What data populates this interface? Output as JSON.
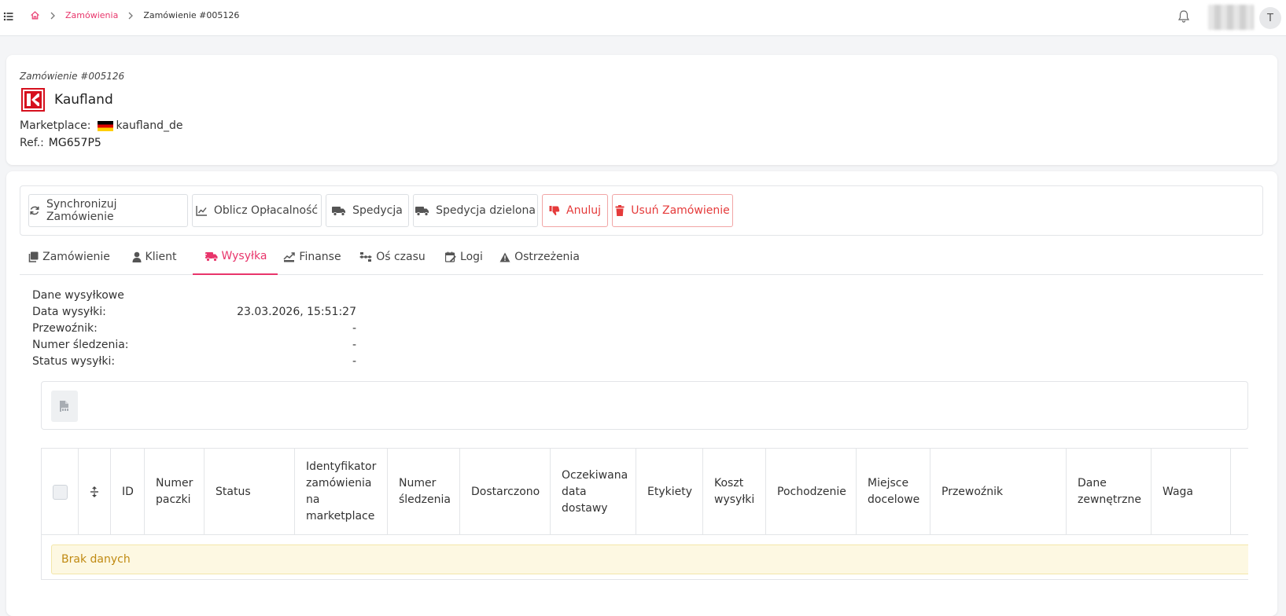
{
  "topbar": {
    "breadcrumb": {
      "home_icon": "home-icon",
      "link": "Zamówienia",
      "current": "Zamówienie #005126"
    },
    "avatar_letter": "T"
  },
  "header": {
    "order_number": "Zamówienie #005126",
    "shop_name": "Kaufland",
    "marketplace_label": "Marketplace:",
    "marketplace_value": "kaufland_de",
    "ref_label": "Ref.:",
    "ref_value": "MG657P5"
  },
  "actions": {
    "sync": "Synchronizuj Zamówienie",
    "profit": "Oblicz Opłacalność",
    "shipment": "Spedycja",
    "split_shipment": "Spedycja dzielona",
    "cancel": "Anuluj",
    "delete": "Usuń Zamówienie"
  },
  "tabs": {
    "order": "Zamówienie",
    "client": "Klient",
    "shipping": "Wysyłka",
    "finance": "Finanse",
    "timeline": "Oś czasu",
    "logs": "Logi",
    "warnings": "Ostrzeżenia"
  },
  "shipping": {
    "title": "Dane wysyłkowe",
    "date_label": "Data wysyłki:",
    "date_value": "23.03.2026, 15:51:27",
    "carrier_label": "Przewoźnik:",
    "carrier_value": "-",
    "tracking_label": "Numer śledzenia:",
    "tracking_value": "-",
    "status_label": "Status wysyłki:",
    "status_value": "-"
  },
  "table": {
    "col_id": "ID",
    "col_package_1": "Numer",
    "col_package_2": "paczki",
    "col_status": "Status",
    "col_mp_1": "Identyfikator",
    "col_mp_2": "zamówienia",
    "col_mp_3": "na",
    "col_mp_4": "marketplace",
    "col_tracking_1": "Numer",
    "col_tracking_2": "śledzenia",
    "col_delivered": "Dostarczono",
    "col_expected_1": "Oczekiwana",
    "col_expected_2": "data",
    "col_expected_3": "dostawy",
    "col_labels": "Etykiety",
    "col_cost_1": "Koszt",
    "col_cost_2": "wysyłki",
    "col_origin": "Pochodzenie",
    "col_dest_1": "Miejsce",
    "col_dest_2": "docelowe",
    "col_carrier": "Przewoźnik",
    "col_ext_1": "Dane",
    "col_ext_2": "zewnętrzne",
    "col_weight": "Waga",
    "empty": "Brak danych"
  },
  "colors": {
    "accent": "#e8356b",
    "danger": "#e53a3a",
    "kaufland_red": "#d6101e",
    "empty_bg": "#fdf8e2",
    "empty_text": "#c08a12"
  }
}
